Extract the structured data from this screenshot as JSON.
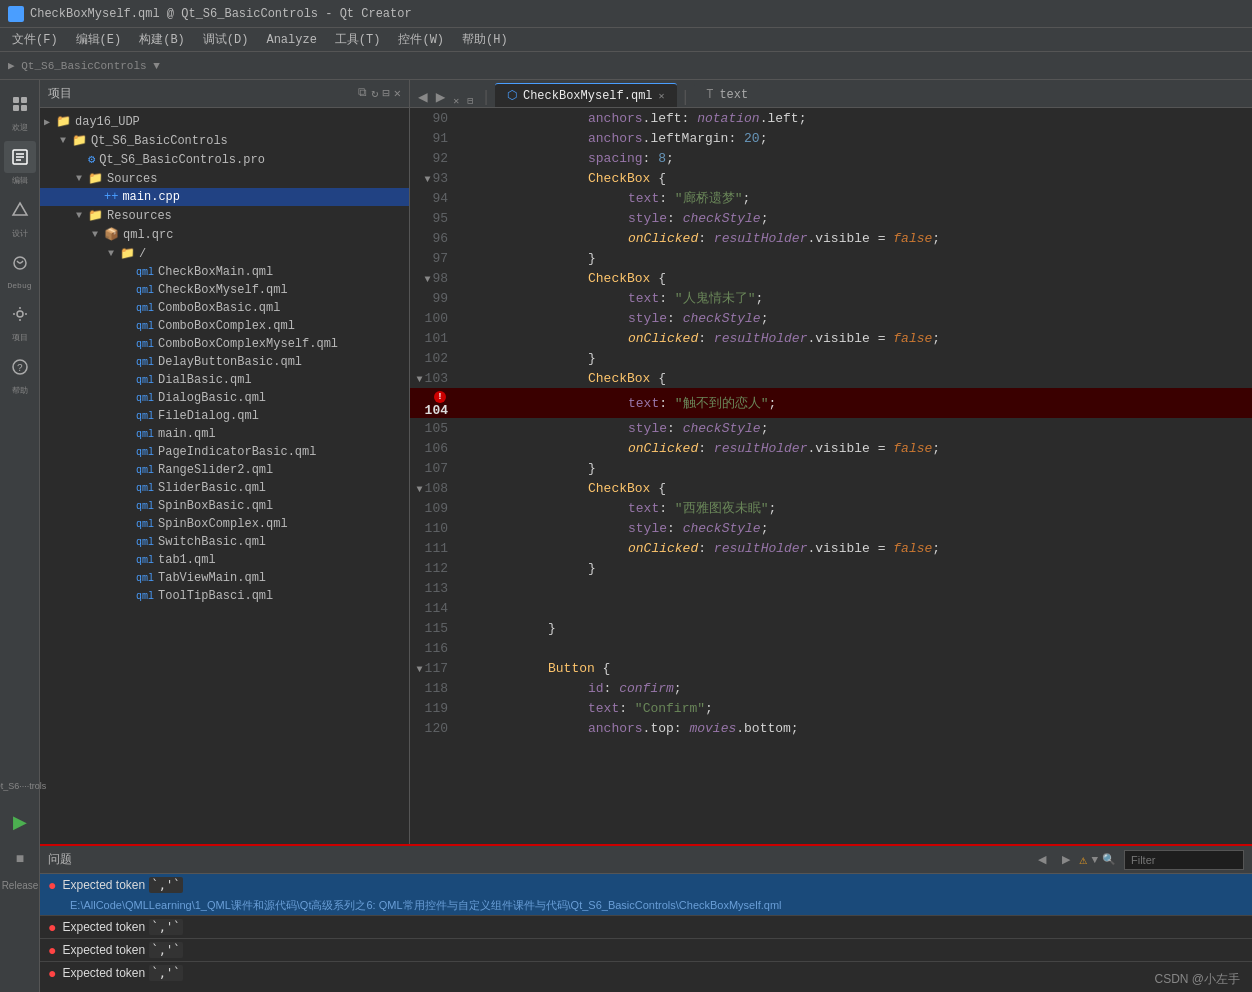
{
  "window": {
    "title": "CheckBoxMyself.qml @ Qt_S6_BasicControls - Qt Creator"
  },
  "menubar": {
    "items": [
      "文件(F)",
      "编辑(E)",
      "构建(B)",
      "调试(D)",
      "Analyze",
      "工具(T)",
      "控件(W)",
      "帮助(H)"
    ]
  },
  "sidebar": {
    "icons": [
      {
        "name": "welcome-icon",
        "label": "欢迎",
        "symbol": "⊞"
      },
      {
        "name": "edit-icon",
        "label": "编辑",
        "symbol": "✎"
      },
      {
        "name": "design-icon",
        "label": "设计",
        "symbol": "◈"
      },
      {
        "name": "debug-icon",
        "label": "Debug",
        "symbol": "🐛"
      },
      {
        "name": "project-icon",
        "label": "项目",
        "symbol": "⚙"
      },
      {
        "name": "help-icon",
        "label": "帮助",
        "symbol": "?"
      }
    ]
  },
  "project_panel": {
    "title": "项目",
    "tree": [
      {
        "id": "day16_udp",
        "label": "day16_UDP",
        "level": 0,
        "type": "folder",
        "expanded": true
      },
      {
        "id": "qt_s6_basic",
        "label": "Qt_S6_BasicControls",
        "level": 1,
        "type": "folder",
        "expanded": true
      },
      {
        "id": "pro_file",
        "label": "Qt_S6_BasicControls.pro",
        "level": 2,
        "type": "pro"
      },
      {
        "id": "sources",
        "label": "Sources",
        "level": 2,
        "type": "folder",
        "expanded": true
      },
      {
        "id": "main_cpp",
        "label": "main.cpp",
        "level": 3,
        "type": "cpp",
        "selected": true
      },
      {
        "id": "resources",
        "label": "Resources",
        "level": 2,
        "type": "folder",
        "expanded": true
      },
      {
        "id": "qml_qrc",
        "label": "qml.qrc",
        "level": 3,
        "type": "qrc",
        "expanded": true
      },
      {
        "id": "slash",
        "label": "/",
        "level": 4,
        "type": "folder",
        "expanded": true
      },
      {
        "id": "checkbox_main",
        "label": "CheckBoxMain.qml",
        "level": 5,
        "type": "qml"
      },
      {
        "id": "checkbox_myself",
        "label": "CheckBoxMyself.qml",
        "level": 5,
        "type": "qml"
      },
      {
        "id": "combobox_basic",
        "label": "ComboBoxBasic.qml",
        "level": 5,
        "type": "qml"
      },
      {
        "id": "combobox_complex",
        "label": "ComboBoxComplex.qml",
        "level": 5,
        "type": "qml"
      },
      {
        "id": "combobox_complex_myself",
        "label": "ComboBoxComplexMyself.qml",
        "level": 5,
        "type": "qml"
      },
      {
        "id": "delay_button_basic",
        "label": "DelayButtonBasic.qml",
        "level": 5,
        "type": "qml"
      },
      {
        "id": "dial_basic",
        "label": "DialBasic.qml",
        "level": 5,
        "type": "qml"
      },
      {
        "id": "dialog_basic",
        "label": "DialogBasic.qml",
        "level": 5,
        "type": "qml"
      },
      {
        "id": "file_dialog",
        "label": "FileDialog.qml",
        "level": 5,
        "type": "qml"
      },
      {
        "id": "main_qml",
        "label": "main.qml",
        "level": 5,
        "type": "qml"
      },
      {
        "id": "page_indicator_basic",
        "label": "PageIndicatorBasic.qml",
        "level": 5,
        "type": "qml"
      },
      {
        "id": "range_slider2",
        "label": "RangeSlider2.qml",
        "level": 5,
        "type": "qml"
      },
      {
        "id": "slider_basic",
        "label": "SliderBasic.qml",
        "level": 5,
        "type": "qml"
      },
      {
        "id": "spinbox_basic",
        "label": "SpinBoxBasic.qml",
        "level": 5,
        "type": "qml"
      },
      {
        "id": "spinbox_complex",
        "label": "SpinBoxComplex.qml",
        "level": 5,
        "type": "qml"
      },
      {
        "id": "switch_basic",
        "label": "SwitchBasic.qml",
        "level": 5,
        "type": "qml"
      },
      {
        "id": "tab1",
        "label": "tab1.qml",
        "level": 5,
        "type": "qml"
      },
      {
        "id": "tabview_main",
        "label": "TabViewMain.qml",
        "level": 5,
        "type": "qml"
      },
      {
        "id": "tooltip_basic",
        "label": "ToolTipBasci.qml",
        "level": 5,
        "type": "qml"
      }
    ]
  },
  "tabs": [
    {
      "id": "checkbox_myself_tab",
      "label": "CheckBoxMyself.qml",
      "active": true,
      "icon": "qml"
    },
    {
      "id": "text_tab",
      "label": "text",
      "active": false,
      "icon": "text"
    }
  ],
  "code": {
    "lines": [
      {
        "num": 90,
        "indent": 12,
        "fold": false,
        "content": "anchors.left: <kw>notation</kw>.left;"
      },
      {
        "num": 91,
        "indent": 12,
        "fold": false,
        "content": "anchors.leftMargin: <num>20</num>;"
      },
      {
        "num": 92,
        "indent": 12,
        "fold": false,
        "content": "spacing: <num>8</num>;"
      },
      {
        "num": 93,
        "indent": 12,
        "fold": true,
        "content": "<type>CheckBox</type> {"
      },
      {
        "num": 94,
        "indent": 16,
        "fold": false,
        "content": "text: <str>\"廊桥遗梦\"</str>;"
      },
      {
        "num": 95,
        "indent": 16,
        "fold": false,
        "content": "style: <id-val>checkStyle</id-val>;"
      },
      {
        "num": 96,
        "indent": 16,
        "fold": false,
        "content": "onClicked: <kw>resultHolder</kw>.visible = <kw>false</kw>;"
      },
      {
        "num": 97,
        "indent": 12,
        "fold": false,
        "content": "}"
      },
      {
        "num": 98,
        "indent": 12,
        "fold": true,
        "content": "<type>CheckBox</type> {"
      },
      {
        "num": 99,
        "indent": 16,
        "fold": false,
        "content": "text: <str>\"人鬼情未了\"</str>;"
      },
      {
        "num": 100,
        "indent": 16,
        "fold": false,
        "content": "style: <id-val>checkStyle</id-val>;"
      },
      {
        "num": 101,
        "indent": 16,
        "fold": false,
        "content": "onClicked: <kw>resultHolder</kw>.visible = <kw>false</kw>;"
      },
      {
        "num": 102,
        "indent": 12,
        "fold": false,
        "content": "}"
      },
      {
        "num": 103,
        "indent": 12,
        "fold": true,
        "content": "<type>CheckBox</type> {"
      },
      {
        "num": 104,
        "indent": 16,
        "fold": false,
        "content": "text: <str>\"触不到的恋人\"</str>;",
        "error": true
      },
      {
        "num": 105,
        "indent": 16,
        "fold": false,
        "content": "style: <id-val>checkStyle</id-val>;"
      },
      {
        "num": 106,
        "indent": 16,
        "fold": false,
        "content": "onClicked: <kw>resultHolder</kw>.visible = <kw>false</kw>;"
      },
      {
        "num": 107,
        "indent": 12,
        "fold": false,
        "content": "}"
      },
      {
        "num": 108,
        "indent": 12,
        "fold": true,
        "content": "<type>CheckBox</type> {"
      },
      {
        "num": 109,
        "indent": 16,
        "fold": false,
        "content": "text: <str>\"西雅图夜未眠\"</str>;"
      },
      {
        "num": 110,
        "indent": 16,
        "fold": false,
        "content": "style: <id-val>checkStyle</id-val>;"
      },
      {
        "num": 111,
        "indent": 16,
        "fold": false,
        "content": "onClicked: <kw>resultHolder</kw>.visible = <kw>false</kw>;"
      },
      {
        "num": 112,
        "indent": 12,
        "fold": false,
        "content": "}"
      },
      {
        "num": 113,
        "indent": 0,
        "fold": false,
        "content": ""
      },
      {
        "num": 114,
        "indent": 0,
        "fold": false,
        "content": ""
      },
      {
        "num": 115,
        "indent": 8,
        "fold": false,
        "content": "}"
      },
      {
        "num": 116,
        "indent": 0,
        "fold": false,
        "content": ""
      },
      {
        "num": 117,
        "indent": 8,
        "fold": true,
        "content": "<type>Button</type> {"
      },
      {
        "num": 118,
        "indent": 12,
        "fold": false,
        "content": "id: <id-val>confirm</id-val>;"
      },
      {
        "num": 119,
        "indent": 12,
        "fold": false,
        "content": "text: <str>\"Confirm\"</str>;"
      },
      {
        "num": 120,
        "indent": 12,
        "fold": false,
        "content": "anchors.top: <kw>movies</kw>.bottom;"
      }
    ]
  },
  "problems": {
    "title": "问题",
    "filter_placeholder": "Filter",
    "items": [
      {
        "type": "error",
        "text": "Expected token `,`",
        "path": "E:\\AllCode\\QMLLearning\\1_QML课件和源代码\\Qt高级系列之6: QML常用控件与自定义组件课件与代码\\Qt_S6_BasicControls\\CheckBoxMyself.qml",
        "selected": true
      },
      {
        "type": "error",
        "text": "Expected token `,`",
        "path": ""
      },
      {
        "type": "error",
        "text": "Expected token `,`",
        "path": ""
      },
      {
        "type": "error",
        "text": "Expected token `,`",
        "path": ""
      }
    ]
  },
  "statusbar": {
    "watermark": "CSDN @小左手"
  },
  "release_label": "Release"
}
